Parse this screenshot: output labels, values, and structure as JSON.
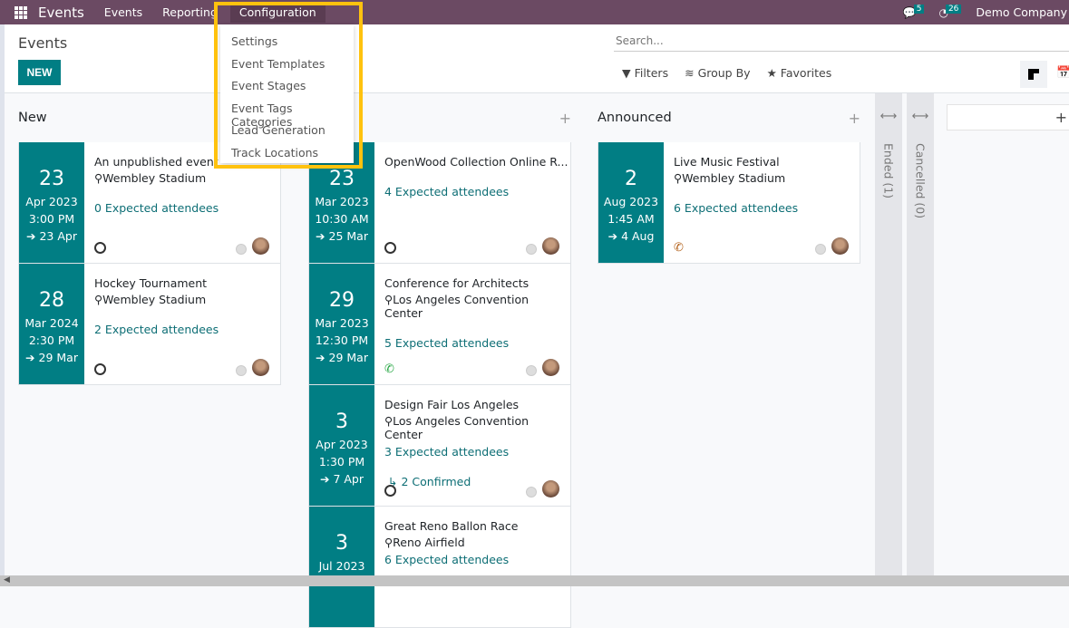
{
  "nav": {
    "brand": "Events",
    "menus": [
      "Events",
      "Reporting",
      "Configuration"
    ],
    "messages_count": "5",
    "activities_count": "26",
    "company": "Demo Company"
  },
  "control": {
    "title": "Events",
    "new_label": "NEW",
    "search_placeholder": "Search...",
    "filters": "Filters",
    "group_by": "Group By",
    "favorites": "Favorites"
  },
  "dropdown": [
    "Settings",
    "Event Templates",
    "Event Stages",
    "Event Tags Categories",
    "Lead Generation",
    "Track Locations"
  ],
  "accent": "#017e84",
  "nav_color": "#6b4a63",
  "highlight": "#ffc20e",
  "columns": [
    {
      "title": "New",
      "cards": [
        {
          "day": "23",
          "month": "Apr 2023",
          "time": "3:00 PM",
          "end": "23 Apr",
          "name": "An unpublished event",
          "location": "Wembley Stadium",
          "attendees": "0 Expected attendees",
          "activity": "clock-icon"
        },
        {
          "day": "28",
          "month": "Mar 2024",
          "time": "2:30 PM",
          "end": "29 Mar",
          "name": "Hockey Tournament",
          "location": "Wembley Stadium",
          "attendees": "2 Expected attendees",
          "activity": "clock-icon"
        }
      ]
    },
    {
      "title": "",
      "cards": [
        {
          "day": "23",
          "month": "Mar 2023",
          "time": "10:30 AM",
          "end": "25 Mar",
          "name": "OpenWood Collection Online R...",
          "location": "",
          "attendees": "4 Expected attendees",
          "activity": "clock-icon"
        },
        {
          "day": "29",
          "month": "Mar 2023",
          "time": "12:30 PM",
          "end": "29 Mar",
          "name": "Conference for Architects",
          "location": "Los Angeles Convention Center",
          "attendees": "5 Expected attendees",
          "activity": "phone-icon"
        },
        {
          "day": "3",
          "month": "Apr 2023",
          "time": "1:30 PM",
          "end": "7 Apr",
          "name": "Design Fair Los Angeles",
          "location": "Los Angeles Convention Center",
          "attendees": "3 Expected attendees",
          "confirmed": "2 Confirmed",
          "activity": "clock-icon"
        },
        {
          "day": "3",
          "month": "Jul 2023",
          "name": "Great Reno Ballon Race",
          "location": "Reno Airfield",
          "attendees": "6 Expected attendees"
        }
      ]
    },
    {
      "title": "Announced",
      "cards": [
        {
          "day": "2",
          "month": "Aug 2023",
          "time": "1:45 AM",
          "end": "4 Aug",
          "name": "Live Music Festival",
          "location": "Wembley Stadium",
          "attendees": "6 Expected attendees",
          "activity": "phone-icon"
        }
      ]
    }
  ],
  "folded": [
    {
      "title": "Ended (1)"
    },
    {
      "title": "Cancelled (0)"
    }
  ]
}
